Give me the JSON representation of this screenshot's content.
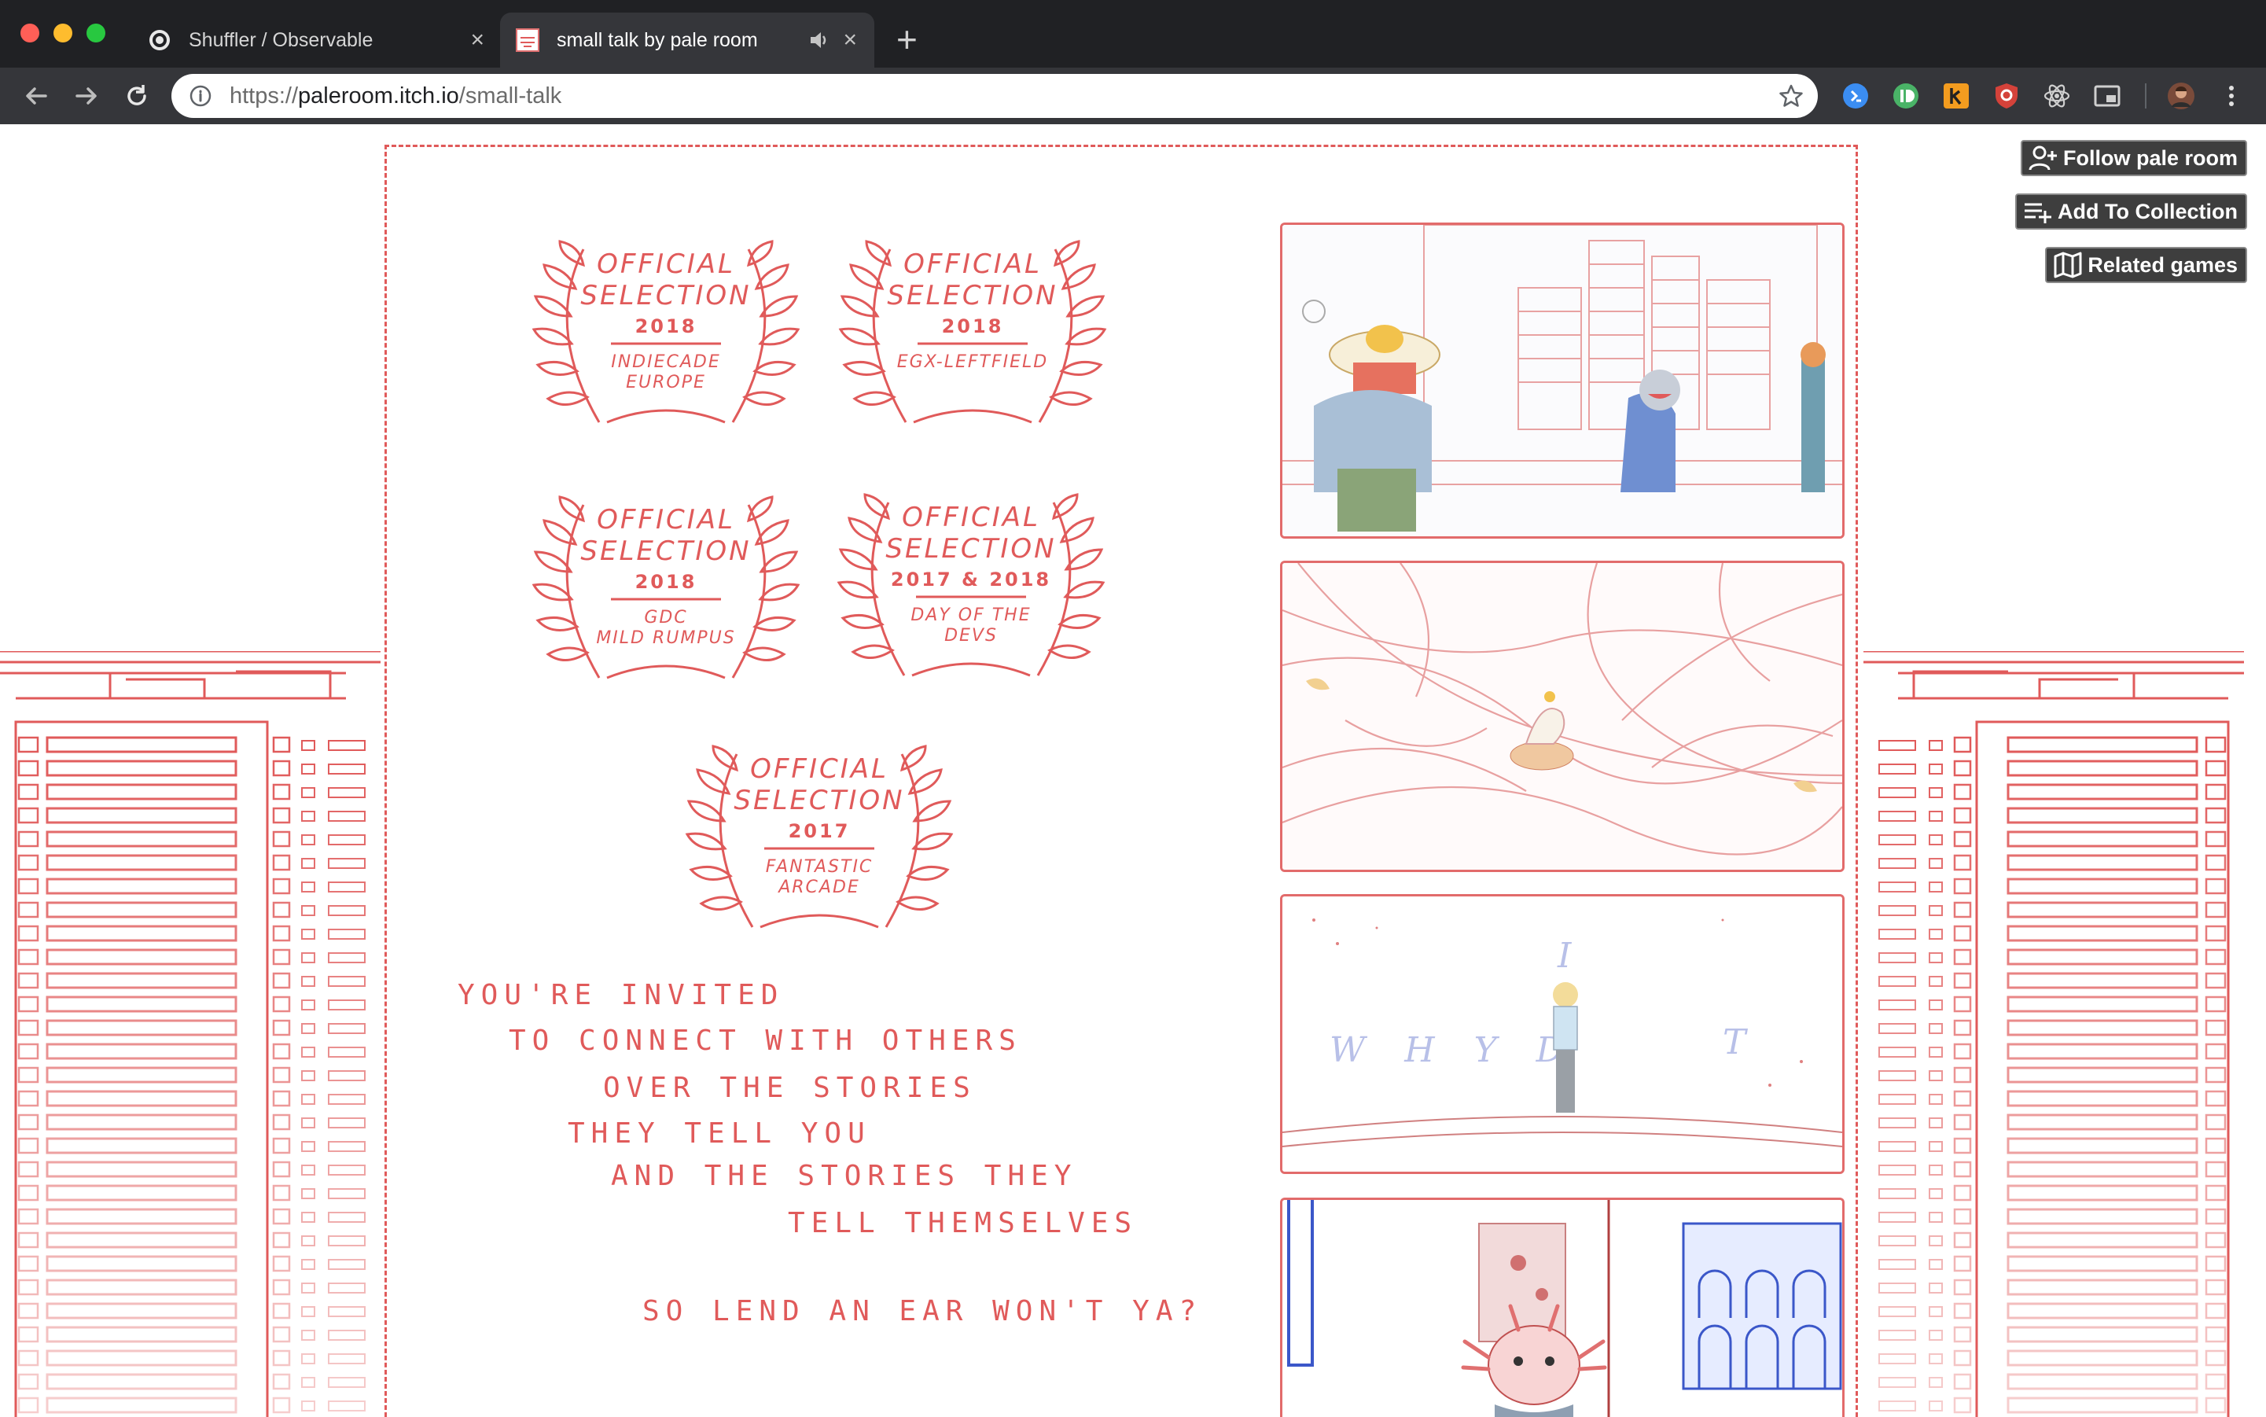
{
  "browser": {
    "tabs": [
      {
        "title": "Shuffler / Observable",
        "active": false,
        "favicon": "observable-icon"
      },
      {
        "title": "small talk by pale room",
        "active": true,
        "favicon": "pale-room-icon",
        "audio": true
      }
    ],
    "url": {
      "scheme": "https://",
      "host": "paleroom.itch.io",
      "path": "/small-talk"
    },
    "extensions": [
      "1password-icon",
      "pushbullet-icon",
      "keepa-icon",
      "ublock-shield-icon",
      "react-devtools-icon",
      "picture-in-picture-icon",
      "profile-avatar"
    ]
  },
  "itch": {
    "follow_label": "Follow pale room",
    "collection_label": "Add To Collection",
    "related_label": "Related games"
  },
  "page": {
    "awards": [
      {
        "line1": "OFFICIAL",
        "line2": "SELECTION",
        "year": "2018",
        "festival": "INDIECADE",
        "festival2": "EUROPE"
      },
      {
        "line1": "OFFICIAL",
        "line2": "SELECTION",
        "year": "2018",
        "festival": "EGX-LEFTFIELD",
        "festival2": ""
      },
      {
        "line1": "OFFICIAL",
        "line2": "SELECTION",
        "year": "2018",
        "festival": "GDC",
        "festival2": "MILD RUMPUS"
      },
      {
        "line1": "OFFICIAL",
        "line2": "SELECTION",
        "year": "2017 & 2018",
        "festival": "DAY OF THE",
        "festival2": "DEVS"
      },
      {
        "line1": "OFFICIAL",
        "line2": "SELECTION",
        "year": "2017",
        "festival": "FANTASTIC",
        "festival2": "ARCADE"
      }
    ],
    "poem": [
      "YOU'RE INVITED",
      "TO CONNECT WITH OTHERS",
      "OVER THE STORIES",
      "THEY TELL YOU",
      "AND THE STORIES THEY",
      "TELL THEMSELVES",
      "SO LEND AN EAR WON'T YA?"
    ],
    "screenshot_texts": {
      "sky_letters": "W H Y D",
      "floating_letter_1": "I",
      "floating_letter_2": "T"
    }
  },
  "colors": {
    "accent_red": "#e05a5a",
    "chrome_dark": "#202124",
    "toolbar": "#35363a",
    "itch_button": "#3e3e3e"
  }
}
